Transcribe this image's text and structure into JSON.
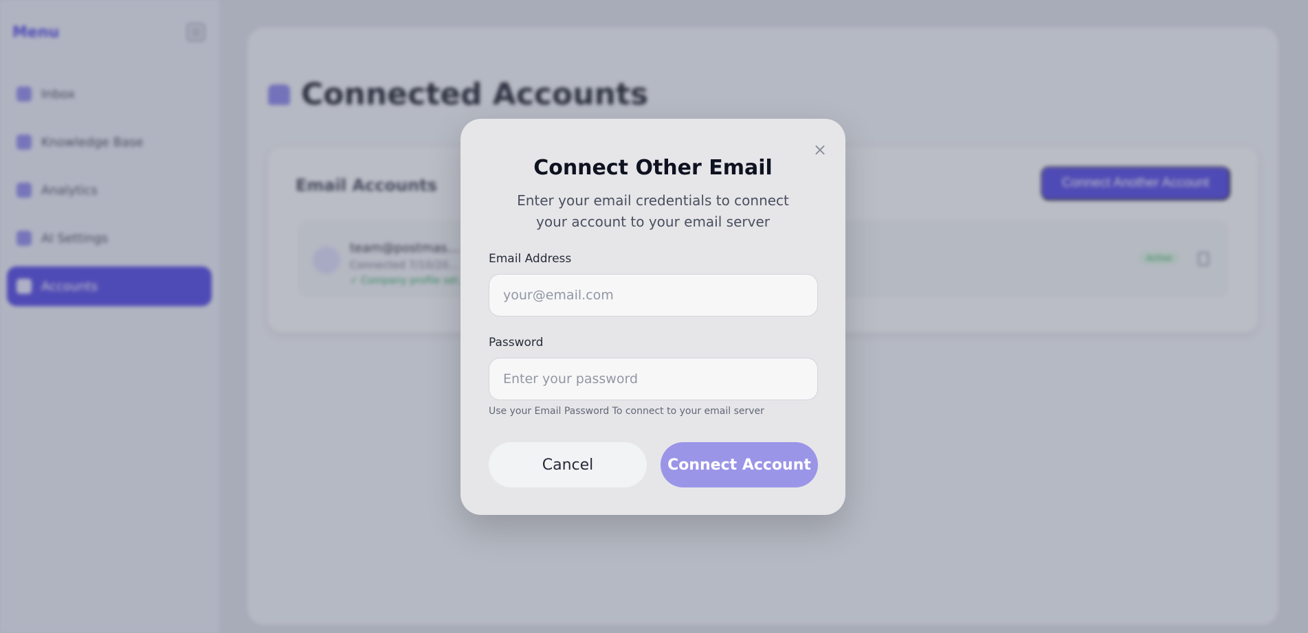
{
  "sidebar": {
    "title": "Menu",
    "items": [
      {
        "label": "Inbox"
      },
      {
        "label": "Knowledge Base"
      },
      {
        "label": "Analytics"
      },
      {
        "label": "AI Settings"
      },
      {
        "label": "Accounts"
      }
    ]
  },
  "main": {
    "page_title": "Connected Accounts",
    "panel_title": "Email Accounts",
    "connect_another_label": "Connect Another Account",
    "account": {
      "email": "team@postmas…",
      "meta": "Connected 7/10/20…",
      "sync": "✓ Company profile set…",
      "badge": "Active"
    }
  },
  "modal": {
    "title": "Connect Other Email",
    "subtitle": "Enter your email credentials to connect your account to your email server",
    "close_glyph": "×",
    "email_label": "Email Address",
    "email_placeholder": "your@email.com",
    "email_value": "",
    "password_label": "Password",
    "password_placeholder": "Enter your password",
    "password_value": "",
    "help_text": "Use your Email Password To connect to your email server",
    "cancel_label": "Cancel",
    "connect_label": "Connect Account"
  },
  "colors": {
    "accent": "#4a3fe0",
    "connect_button_disabled": "#9b95e8",
    "modal_bg": "#e6e6e9"
  },
  "icons": [
    "hamburger-icon",
    "inbox-icon",
    "knowledge-base-icon",
    "analytics-icon",
    "ai-settings-icon",
    "accounts-icon",
    "accounts-header-icon",
    "close-icon",
    "trash-icon"
  ]
}
